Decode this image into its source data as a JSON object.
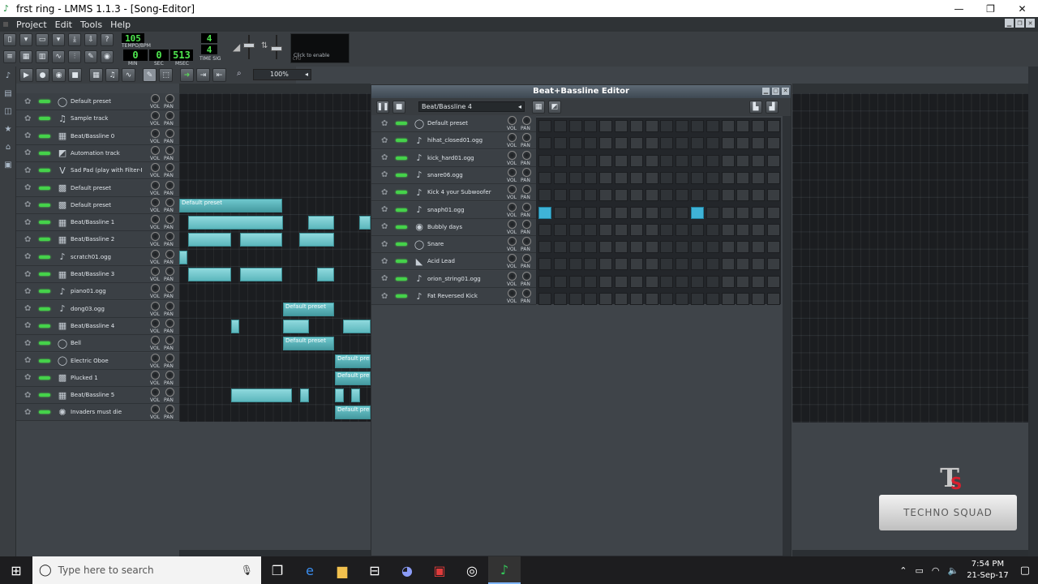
{
  "window": {
    "title": "frst ring - LMMS 1.1.3 - [Song-Editor]",
    "controls": [
      "—",
      "❐",
      "✕"
    ]
  },
  "menu": {
    "items": [
      "Project",
      "Edit",
      "Tools",
      "Help"
    ]
  },
  "toolbar": {
    "tempo_value": "105",
    "tempo_label": "TEMPO/BPM",
    "time_min": "0",
    "time_sec": "0",
    "time_msec": "513",
    "min_label": "MIN",
    "sec_label": "SEC",
    "msec_label": "MSEC",
    "timesig_num": "4",
    "timesig_den": "4",
    "timesig_label": "TIME SIG",
    "cpu_text": "Click to enable",
    "cpu_label": "CPU"
  },
  "edit_toolbar": {
    "zoom": "100%"
  },
  "knob_labels": {
    "vol": "VOL",
    "pan": "PAN"
  },
  "song_tracks": [
    {
      "name": "Default preset",
      "icon": "preset-icon"
    },
    {
      "name": "Sample track",
      "icon": "sample-icon"
    },
    {
      "name": "Beat/Bassline 0",
      "icon": "bb-icon"
    },
    {
      "name": "Automation track",
      "icon": "automation-icon"
    },
    {
      "name": "Sad Pad (play with Filter-R",
      "icon": "vibed-icon"
    },
    {
      "name": "Default preset",
      "icon": "tripleosc-icon"
    },
    {
      "name": "Default preset",
      "icon": "tripleosc-icon"
    },
    {
      "name": "Beat/Bassline 1",
      "icon": "bb-icon"
    },
    {
      "name": "Beat/Bassline 2",
      "icon": "bb-icon"
    },
    {
      "name": "scratch01.ogg",
      "icon": "audiofile-icon"
    },
    {
      "name": "Beat/Bassline 3",
      "icon": "bb-icon"
    },
    {
      "name": "piano01.ogg",
      "icon": "audiofile-icon"
    },
    {
      "name": "dong03.ogg",
      "icon": "audiofile-icon"
    },
    {
      "name": "Beat/Bassline 4",
      "icon": "bb-icon"
    },
    {
      "name": "Bell",
      "icon": "preset-icon"
    },
    {
      "name": "Electric Oboe",
      "icon": "preset-icon"
    },
    {
      "name": "Plucked 1",
      "icon": "tripleosc-icon"
    },
    {
      "name": "Beat/Bassline 5",
      "icon": "bb-icon"
    },
    {
      "name": "Invaders must die",
      "icon": "bitinvader-icon"
    }
  ],
  "clip_labels": {
    "default_preset": "Default preset",
    "default_preset_short": "Default prese"
  },
  "bb_editor": {
    "title": "Beat+Bassline Editor",
    "selected_bb": "Beat/Bassline 4",
    "tracks": [
      {
        "name": "Default preset",
        "icon": "preset-icon"
      },
      {
        "name": "hihat_closed01.ogg",
        "icon": "audiofile-icon"
      },
      {
        "name": "kick_hard01.ogg",
        "icon": "audiofile-icon"
      },
      {
        "name": "snare06.ogg",
        "icon": "audiofile-icon"
      },
      {
        "name": "Kick 4 your Subwoofer",
        "icon": "audiofile-icon"
      },
      {
        "name": "snaph01.ogg",
        "icon": "audiofile-icon"
      },
      {
        "name": "Bubbly days",
        "icon": "organic-icon"
      },
      {
        "name": "Snare",
        "icon": "preset-icon"
      },
      {
        "name": "Acid Lead",
        "icon": "lb302-icon"
      },
      {
        "name": "orion_string01.ogg",
        "icon": "audiofile-icon"
      },
      {
        "name": "Fat Reversed Kick",
        "icon": "audiofile-icon"
      }
    ],
    "active_steps": [
      [
        5,
        0
      ],
      [
        5,
        10
      ]
    ]
  },
  "watermark": {
    "logo": "T",
    "logo_s": "S",
    "text": "TECHNO SQUAD"
  },
  "taskbar": {
    "search_placeholder": "Type here to search",
    "time": "7:54 PM",
    "date": "21-Sep-17"
  }
}
